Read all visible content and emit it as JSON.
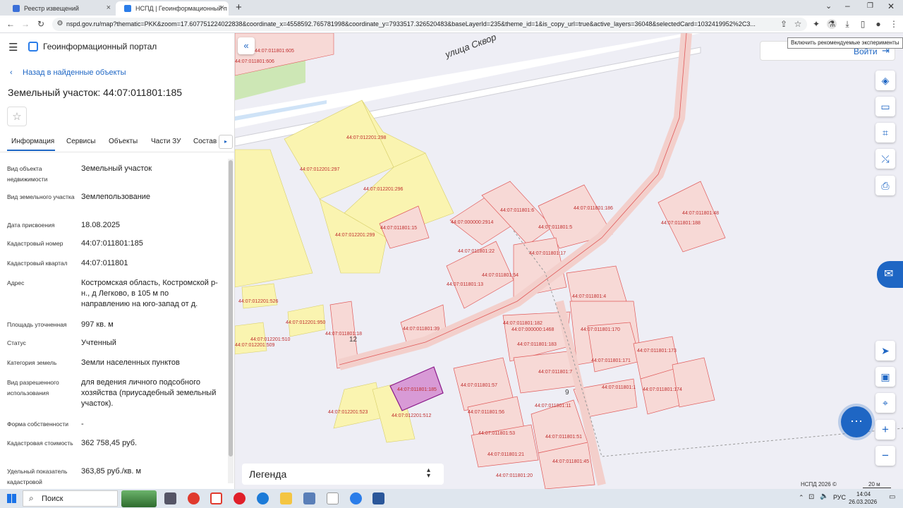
{
  "browser": {
    "tabs": [
      {
        "title": "Реестр извещений"
      },
      {
        "title": "НСПД | Геоинформационный п"
      }
    ],
    "new_tab": "+",
    "url": "nspd.gov.ru/map?thematic=PKK&zoom=17.607751224022838&coordinate_x=4558592.765781998&coordinate_y=7933517.326520483&baseLayerId=235&theme_id=1&is_copy_url=true&active_layers=36048&selectedCard=1032419952%2C3...",
    "tooltip": "Включить рекомендуемые эксперименты"
  },
  "header": {
    "portal_title": "Геоинформационный портал",
    "login": "Войти"
  },
  "panel": {
    "back_link": "Назад в найденные объекты",
    "title": "Земельный участок: 44:07:011801:185",
    "tabs": [
      "Информация",
      "Сервисы",
      "Объекты",
      "Части ЗУ",
      "Состав"
    ],
    "props": [
      {
        "k": "Вид объекта недвижимости",
        "v": "Земельный участок"
      },
      {
        "k": "Вид земельного участка",
        "v": "Землепользование"
      },
      {
        "k": "Дата присвоения",
        "v": "18.08.2025"
      },
      {
        "k": "Кадастровый номер",
        "v": "44:07:011801:185"
      },
      {
        "k": "Кадастровый квартал",
        "v": "44:07:011801"
      },
      {
        "k": "Адрес",
        "v": "Костромская область, Костромской р-н., д Легково, в 105 м по направлению на юго-запад от д."
      },
      {
        "k": "Площадь уточненная",
        "v": "997 кв. м"
      },
      {
        "k": "Статус",
        "v": "Учтенный"
      },
      {
        "k": "Категория земель",
        "v": "Земли населенных пунктов"
      },
      {
        "k": "Вид разрешенного использования",
        "v": "для ведения личного подсобного хозяйства (приусадебный земельный участок)."
      },
      {
        "k": "Форма собственности",
        "v": "-"
      },
      {
        "k": "Кадастровая стоимость",
        "v": "362 758,45 руб."
      },
      {
        "k": "Удельный показатель кадастровой",
        "v": "363,85 руб./кв. м"
      }
    ]
  },
  "map": {
    "street": "улица Сквор",
    "legend": "Легенда",
    "copyright": "НСПД 2026 ©",
    "scale": "20 м",
    "house_numbers": [
      "12",
      "9"
    ],
    "parcels": [
      "44:07:012201:298",
      "44:07:012201:297",
      "44:07:012201:296",
      "44:07:012201:299",
      "44:07:011801:15",
      "44:07:011801:6",
      "44:07:000000:2914",
      "44:07:011801:22",
      "44:07:011801:5",
      "44:07:011801:17",
      "44:07:011801:186",
      "44:07:011801:54",
      "44:07:011801:13",
      "44:07:011801:48",
      "44:07:011801:188",
      "44:07:012201:526",
      "44:07:012201:950",
      "44:07:011801:18",
      "44:07:012201:510",
      "44:07:012201:509",
      "44:07:011801:39",
      "44:07:011801:4",
      "44:07:011801:182",
      "44:07:000000:1468",
      "44:07:011801:170",
      "44:07:011801:183",
      "44:07:011801:173",
      "44:07:011801:171",
      "44:07:011801:185",
      "44:07:011801:57",
      "44:07:011801:7",
      "44:07:011801:1",
      "44:07:011801:174",
      "44:07:012201:523",
      "44:07:012201:512",
      "44:07:011801:56",
      "44:07:011801:11",
      "44:07:011801:53",
      "44:07:011801:51",
      "44:07:011801:21",
      "44:07:011801:45",
      "44:07:011801:20",
      "44:07:011801:605",
      "44:07:011801:606"
    ]
  },
  "taskbar": {
    "search": "Поиск",
    "lang": "РУС",
    "time": "14:04",
    "date": "26.03.2026"
  },
  "colors": {
    "accent": "#1e66c4",
    "parcel_fill": "#f7d9d6",
    "parcel_stroke": "#e05a5a",
    "yellow": "#faf4b0",
    "selected": "#d89ad6"
  }
}
